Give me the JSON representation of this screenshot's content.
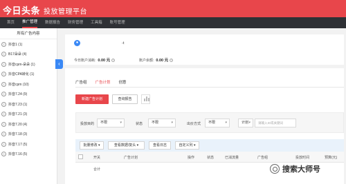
{
  "header": {
    "brand": "今日头条",
    "platform": "投放管理平台",
    "bg_color": "#e8464b"
  },
  "nav": [
    "首页",
    "推广管理",
    "数据报告",
    "财务管理",
    "工具箱",
    "账号管理"
  ],
  "nav_active_index": 1,
  "sidebar": {
    "title": "所有广告内容",
    "items": [
      "抖音1 (1)",
      "B17朵朵 (4)",
      "抖音cpm-朵朵 (1)",
      "抖音CPA转化 (1)",
      "抖音cpm (10)",
      "抖音7.24 (9)",
      "抖音7.23 (1)",
      "抖音7.21 (3)",
      "抖音7.20 (4)",
      "抖音7.18 (3)",
      "抖音7.17 (5)",
      "抖音7.16 (5)"
    ]
  },
  "account": {
    "name": "-t",
    "today_spend_label": "今日账户消耗:",
    "today_spend_value": "0.00 元",
    "balance_label": "账户余额:",
    "balance_value": "0.00 元"
  },
  "tabs": [
    "广告组",
    "广告计划",
    "创意"
  ],
  "tabs_active_index": 1,
  "buttons": {
    "new_plan": "新建广告计划",
    "view_report": "查询报告"
  },
  "filters": {
    "objective_label": "投放目的",
    "objective_value": "不限",
    "status_label": "状态",
    "status_value": "不限",
    "bid_label": "出价方式",
    "bid_value": "不限",
    "plan_select": "计划",
    "search_placeholder": "请输入ID或关键词"
  },
  "actions": [
    "批量修改",
    "查看数据/复头",
    "查看日志",
    "自定义列"
  ],
  "table": {
    "headers": [
      "开关",
      "广告计划",
      "操作",
      "状态",
      "已消流量",
      "广告组",
      "投放时间",
      "预算(元)"
    ],
    "total_row_label": "合计"
  },
  "watermark": "搜索大师号"
}
